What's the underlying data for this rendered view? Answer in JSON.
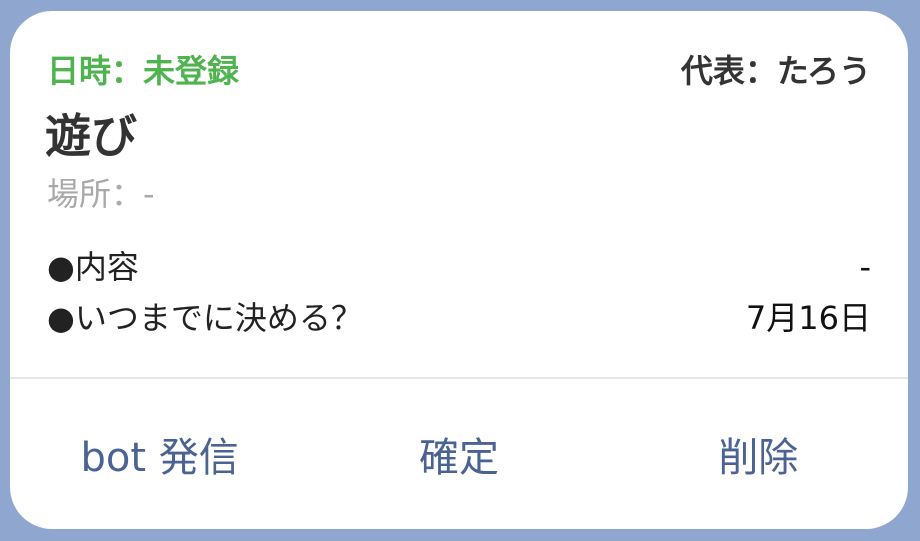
{
  "card": {
    "status": "日時：未登録",
    "representative": "代表：たろう",
    "title": "遊び",
    "place": "場所：-",
    "details": [
      {
        "label": "●内容",
        "value": "-"
      },
      {
        "label": "●いつまでに決める？",
        "value": "7月16日"
      }
    ],
    "actions": {
      "bot_post": "bot 発信",
      "confirm": "確定",
      "delete": "削除"
    }
  },
  "colors": {
    "background": "#8fa6cf",
    "status_green": "#4fb34f",
    "action_blue": "#4a6392",
    "place_gray": "#a9a9a9"
  }
}
